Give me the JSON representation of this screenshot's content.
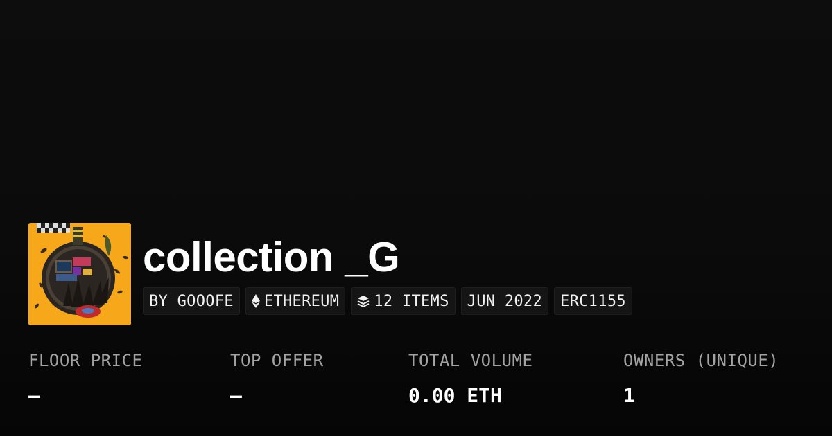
{
  "collection": {
    "name": "collection _G",
    "avatar_icon": "collection-artwork-image"
  },
  "chips": {
    "creator": "BY GOOOFE",
    "chain": "ETHEREUM",
    "chain_icon": "ethereum-icon",
    "items": "12 ITEMS",
    "items_icon": "layers-icon",
    "date": "JUN 2022",
    "standard": "ERC1155"
  },
  "stats": {
    "floor_price": {
      "label": "FLOOR PRICE",
      "value": "–"
    },
    "top_offer": {
      "label": "TOP OFFER",
      "value": "–"
    },
    "total_volume": {
      "label": "TOTAL VOLUME",
      "value": "0.00 ETH"
    },
    "owners": {
      "label": "OWNERS (UNIQUE)",
      "value": "1"
    }
  },
  "colors": {
    "background": "#0b0b0b",
    "chip_background": "#151515",
    "label_gray": "#a3a3a3",
    "avatar_orange": "#f6a71a"
  }
}
